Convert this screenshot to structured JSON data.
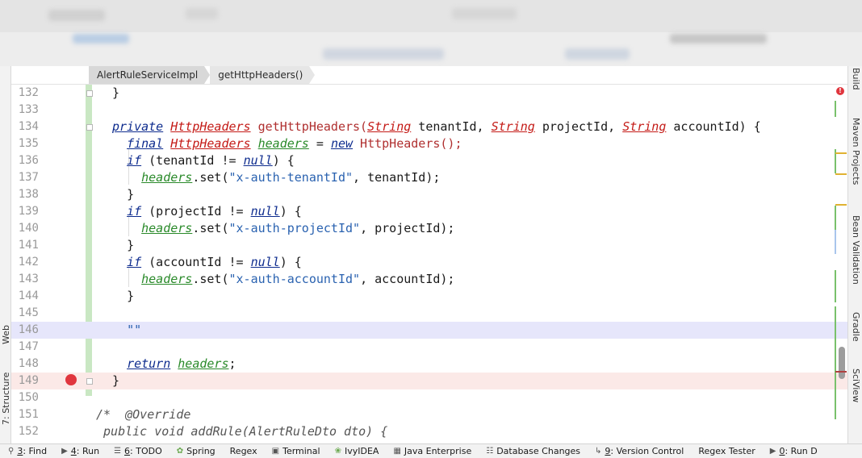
{
  "breadcrumb": {
    "items": [
      "AlertRuleServiceImpl",
      "getHttpHeaders()"
    ]
  },
  "left_tools": {
    "structure": "7: Structure",
    "web": "Web"
  },
  "right_tools": {
    "build": "Build",
    "maven": "Maven Projects",
    "bean_validation": "Bean Validation",
    "gradle": "Gradle",
    "sciview": "SciView"
  },
  "editor": {
    "line_numbers": [
      "132",
      "133",
      "134",
      "135",
      "136",
      "137",
      "138",
      "139",
      "140",
      "141",
      "142",
      "143",
      "144",
      "145",
      "146",
      "147",
      "148",
      "149",
      "150",
      "151",
      "152"
    ],
    "lines": {
      "l132": "}",
      "l134_private": "private",
      "l134_type": "HttpHeaders",
      "l134_name": " getHttpHeaders(",
      "l134_string1": "String",
      "l134_p1": " tenantId, ",
      "l134_string2": "String",
      "l134_p2": " projectId, ",
      "l134_string3": "String",
      "l134_p3": " accountId) {",
      "l135_final": "final",
      "l135_type": "HttpHeaders",
      "l135_var": "headers",
      "l135_eq": " = ",
      "l135_new": "new",
      "l135_ctor": " HttpHeaders();",
      "l136_if": "if",
      "l136_rest": " (tenantId != ",
      "l136_null": "null",
      "l136_end": ") {",
      "l137_var": "headers",
      "l137_call": ".set(",
      "l137_str": "\"x-auth-tenantId\"",
      "l137_end": ", tenantId);",
      "l138": "}",
      "l139_if": "if",
      "l139_rest": " (projectId != ",
      "l139_null": "null",
      "l139_end": ") {",
      "l140_var": "headers",
      "l140_call": ".set(",
      "l140_str": "\"x-auth-projectId\"",
      "l140_end": ", projectId);",
      "l141": "}",
      "l142_if": "if",
      "l142_rest": " (accountId != ",
      "l142_null": "null",
      "l142_end": ") {",
      "l143_var": "headers",
      "l143_call": ".set(",
      "l143_str": "\"x-auth-accountId\"",
      "l143_end": ", accountId);",
      "l144": "}",
      "l146": "\"\"",
      "l148_return": "return",
      "l148_var": "headers",
      "l148_end": ";",
      "l149": "}",
      "l151": "/*  @Override",
      "l152": " public void addRule(AlertRuleDto dto) {"
    }
  },
  "bottom_bar": {
    "find_num": "3",
    "find": ": Find",
    "run_num": "4",
    "run": ": Run",
    "todo_num": "6",
    "todo": ": TODO",
    "spring": "Spring",
    "regex": "Regex",
    "terminal": "Terminal",
    "ivyidea": "IvyIDEA",
    "java_enterprise": "Java Enterprise",
    "database_changes": "Database Changes",
    "vc_num": "9",
    "version_control": ": Version Control",
    "regex_tester": "Regex Tester",
    "run_d_num": "0",
    "run_d": ": Run D"
  }
}
